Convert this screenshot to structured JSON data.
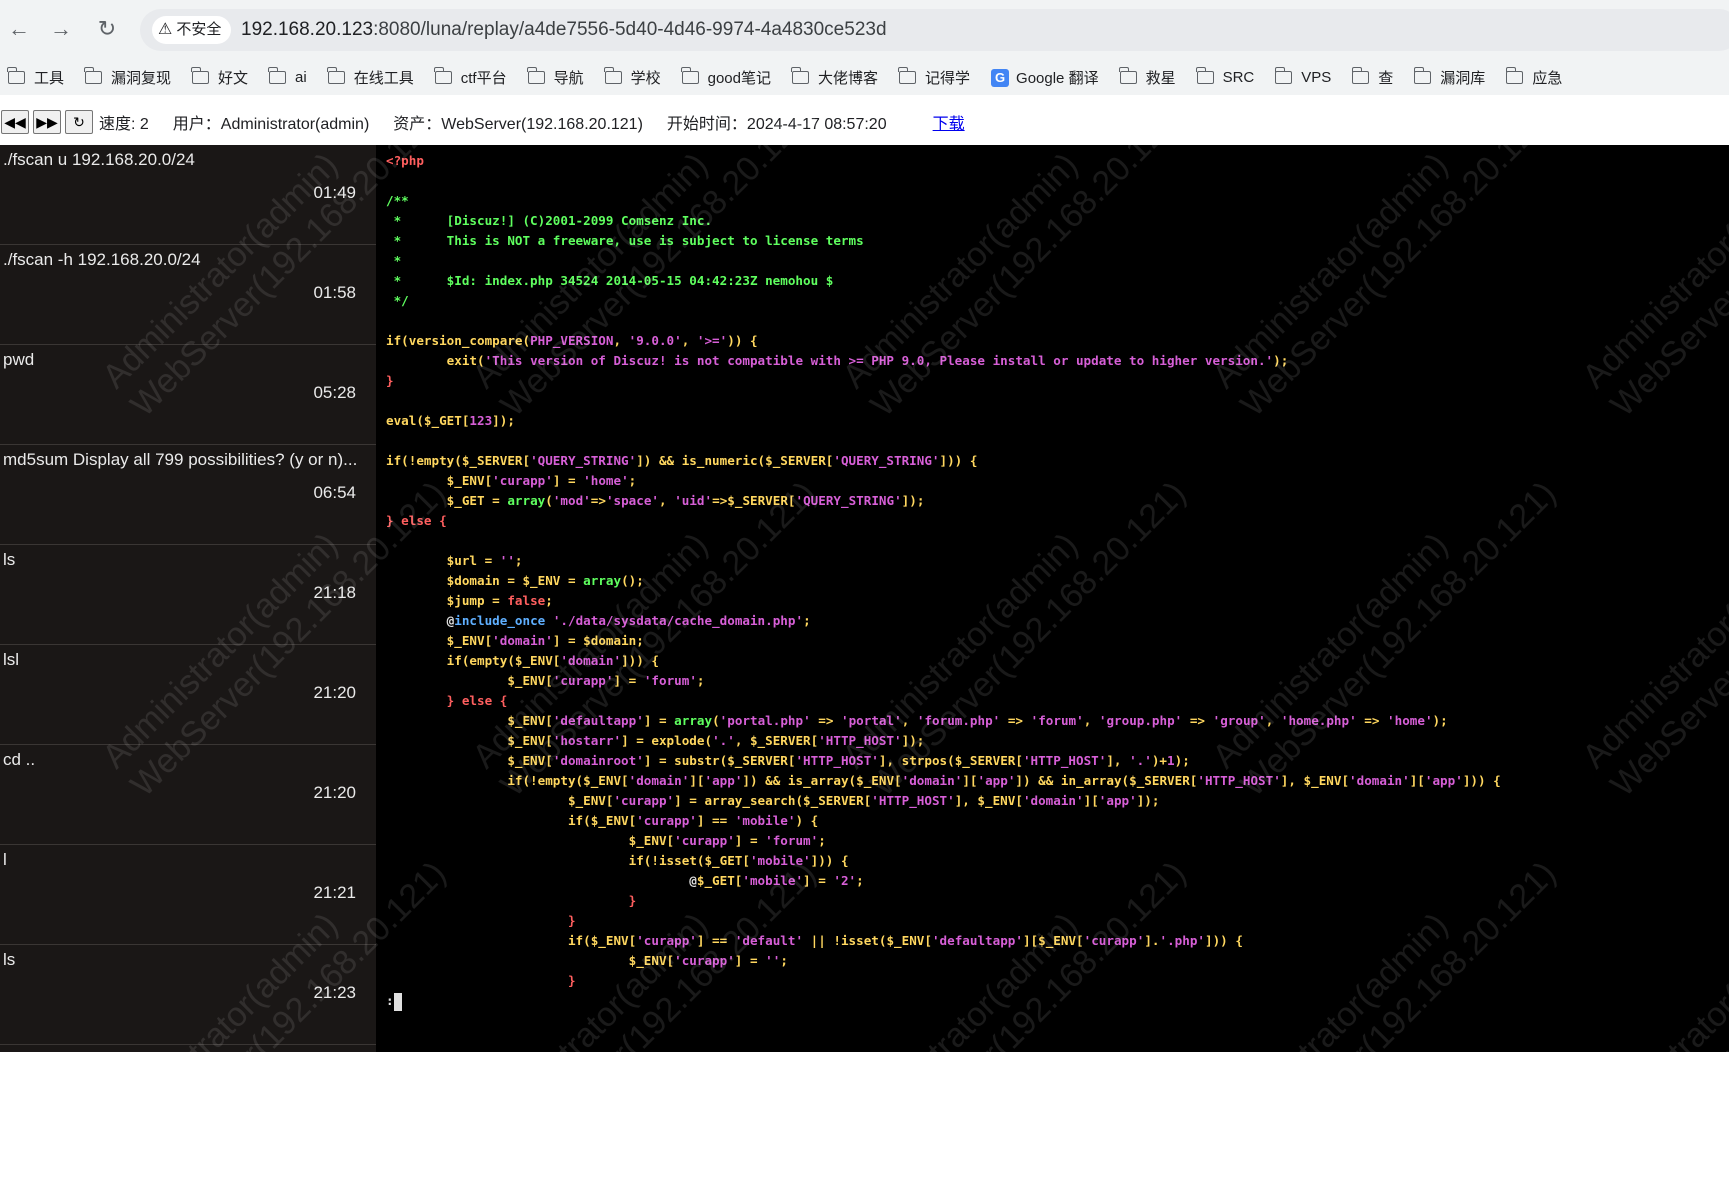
{
  "browser": {
    "security_label": "不安全",
    "url_host": "192.168.20.123",
    "url_rest": ":8080/luna/replay/a4de7556-5d40-4d46-9974-4a4830ce523d"
  },
  "bookmarks": [
    {
      "label": "工具",
      "icon": "folder-icon"
    },
    {
      "label": "漏洞复现",
      "icon": "folder-icon"
    },
    {
      "label": "好文",
      "icon": "folder-icon"
    },
    {
      "label": "ai",
      "icon": "folder-icon"
    },
    {
      "label": "在线工具",
      "icon": "folder-icon"
    },
    {
      "label": "ctf平台",
      "icon": "folder-icon"
    },
    {
      "label": "导航",
      "icon": "folder-icon"
    },
    {
      "label": "学校",
      "icon": "folder-icon"
    },
    {
      "label": "good笔记",
      "icon": "folder-icon"
    },
    {
      "label": "大佬博客",
      "icon": "folder-icon"
    },
    {
      "label": "记得学",
      "icon": "folder-icon"
    },
    {
      "label": "Google 翻译",
      "icon": "google-translate-icon"
    },
    {
      "label": "救星",
      "icon": "folder-icon"
    },
    {
      "label": "SRC",
      "icon": "folder-icon"
    },
    {
      "label": "VPS",
      "icon": "folder-icon"
    },
    {
      "label": "查",
      "icon": "folder-icon"
    },
    {
      "label": "漏洞库",
      "icon": "folder-icon"
    },
    {
      "label": "应急",
      "icon": "folder-icon"
    }
  ],
  "toolbar": {
    "speed": "速度: 2",
    "user": "用户：Administrator(admin)",
    "asset": "资产：WebServer(192.168.20.121)",
    "start_time": "开始时间：2024-4-17 08:57:20",
    "download": "下载"
  },
  "commands": [
    {
      "text": "./fscan u 192.168.20.0/24",
      "time": "01:49"
    },
    {
      "text": "./fscan -h 192.168.20.0/24",
      "time": "01:58"
    },
    {
      "text": "pwd",
      "time": "05:28"
    },
    {
      "text": "md5sum Display all 799 possibilities? (y or n)...",
      "time": "06:54"
    },
    {
      "text": "ls",
      "time": "21:18"
    },
    {
      "text": "lsl",
      "time": "21:20"
    },
    {
      "text": "cd ..",
      "time": "21:20"
    },
    {
      "text": "l",
      "time": "21:21"
    },
    {
      "text": "ls",
      "time": "21:23"
    }
  ],
  "watermark": {
    "line1": "Administrator(admin)",
    "line2": "WebServer(192.168.20.121)"
  },
  "terminal": {
    "prompt": ":"
  },
  "colors": {
    "comment": "#5fff5f",
    "string": "#d75fd7",
    "code": "#ffd75f",
    "keyword": "#ff5f5f"
  }
}
